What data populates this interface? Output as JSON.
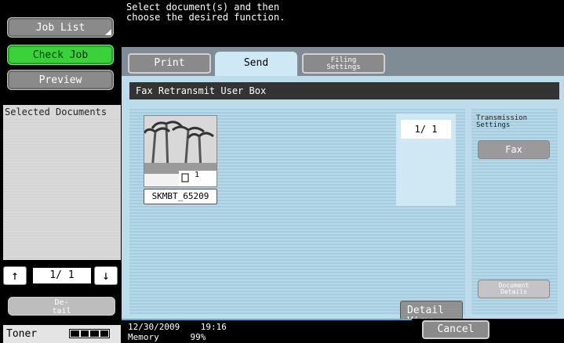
{
  "left": {
    "job_list": "Job List",
    "check_job": "Check Job",
    "preview": "Preview",
    "selected_documents": "Selected Documents",
    "pager": "1/ 1",
    "detail": "De-\ntail",
    "toner": "Toner"
  },
  "header": {
    "message": "Select document(s) and then\nchoose the desired function."
  },
  "tabs": {
    "print": "Print",
    "send": "Send",
    "filing": "Filing\nSettings"
  },
  "main": {
    "box_title": "Fax Retransmit User Box",
    "document": {
      "name": "SKMBT_65209",
      "pages": "1"
    },
    "page_indicator": "1/ 1",
    "detail_view": "Detail\nView",
    "side_title": "Transmission\nSettings",
    "fax": "Fax",
    "document_details": "Document\nDetails"
  },
  "footer": {
    "datetime": "12/30/2009    19:16\nMemory      99%",
    "cancel": "Cancel"
  },
  "colors": {
    "accent_green": "#3bd13b",
    "panel_blue": "#bcdcec"
  }
}
